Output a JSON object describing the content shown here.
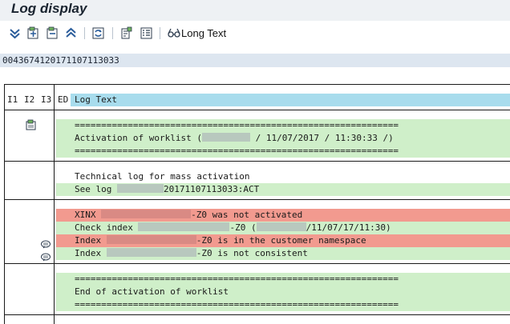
{
  "window": {
    "title": "Log display"
  },
  "toolbar": {
    "buttons": [
      {
        "icon": "expand-all-icon"
      },
      {
        "icon": "expand-subtree-icon"
      },
      {
        "icon": "collapse-subtree-icon"
      },
      {
        "icon": "collapse-all-icon"
      },
      {
        "icon": "refresh-icon"
      },
      {
        "icon": "technical-info-icon"
      },
      {
        "icon": "list-icon"
      }
    ],
    "long_text_label": "Long Text"
  },
  "log_number": "0043674120171107113033",
  "table": {
    "headers": {
      "i1": "I1",
      "i2": "I2",
      "i3": "I3",
      "ed": "ED",
      "log_text": "Log Text"
    },
    "groups": [
      {
        "rows": [
          {
            "color": "green",
            "text": "============================================================="
          },
          {
            "color": "green",
            "parts": [
              "Activation of worklist (",
              "",
              " / 11/07/2017 / 11:30:33 /)"
            ]
          },
          {
            "color": "green",
            "text": "============================================================="
          }
        ]
      },
      {
        "rows": [
          {
            "color": "white",
            "text": "Technical log for mass activation"
          },
          {
            "color": "green",
            "parts": [
              "See log ",
              "",
              "20171107113033:ACT"
            ]
          }
        ]
      },
      {
        "rows": [
          {
            "color": "red",
            "parts": [
              "XINX ",
              "",
              "-Z0 was not activated"
            ]
          },
          {
            "color": "green",
            "parts": [
              "Check index ",
              "",
              "-Z0 (",
              "",
              "/11/07/17/11:30)"
            ]
          },
          {
            "color": "red",
            "parts": [
              "Index ",
              "",
              "-Z0 is in the customer namespace"
            ]
          },
          {
            "color": "green",
            "parts": [
              "Index ",
              "",
              "-Z0 is not consistent"
            ]
          }
        ]
      },
      {
        "rows": [
          {
            "color": "green",
            "text": "============================================================="
          },
          {
            "color": "green",
            "text": "End of activation of worklist"
          },
          {
            "color": "green",
            "text": "============================================================="
          }
        ]
      }
    ]
  },
  "colors": {
    "success_row": "#cfefc9",
    "error_row": "#f29a8f",
    "header_bar": "#a8dced",
    "log_number_bar": "#dde6f0"
  }
}
